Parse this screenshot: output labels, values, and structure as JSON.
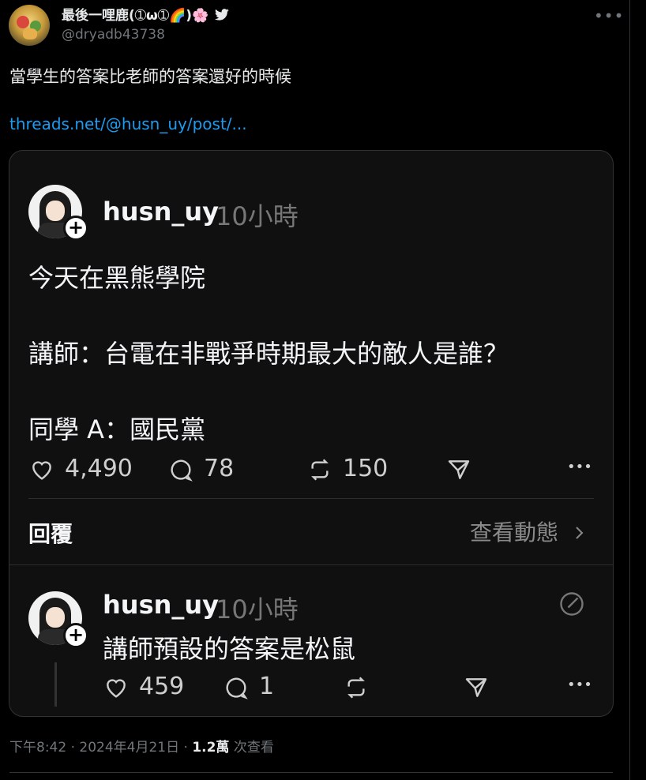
{
  "tweet": {
    "author_name": "最後一哩鹿(➀ω➀🌈)🌸",
    "author_handle": "@dryadb43738",
    "text": "當學生的答案比老師的答案還好的時候",
    "link": "threads.net/@husn_uy/post/...",
    "timestamp": "下午8:42 · 2024年4月21日 · ",
    "views_count": "1.2萬",
    "views_label": " 次查看",
    "more_label": "•••"
  },
  "threads_card": {
    "post": {
      "username": "husn_uy",
      "time": "10小時",
      "lines": [
        "今天在黑熊學院",
        "講師：台電在非戰爭時期最大的敵人是誰？",
        "同學 A：國民黨"
      ],
      "likes": "4,490",
      "comments": "78",
      "reposts": "150"
    },
    "reply_label": "回覆",
    "view_activity": "查看動態",
    "reply": {
      "username": "husn_uy",
      "time": "10小時",
      "text": "講師預設的答案是松鼠",
      "likes": "459",
      "comments": "1"
    },
    "more_label": "•••"
  },
  "colors": {
    "link": "#1d9bf0",
    "background": "#000000",
    "card": "#101010"
  }
}
